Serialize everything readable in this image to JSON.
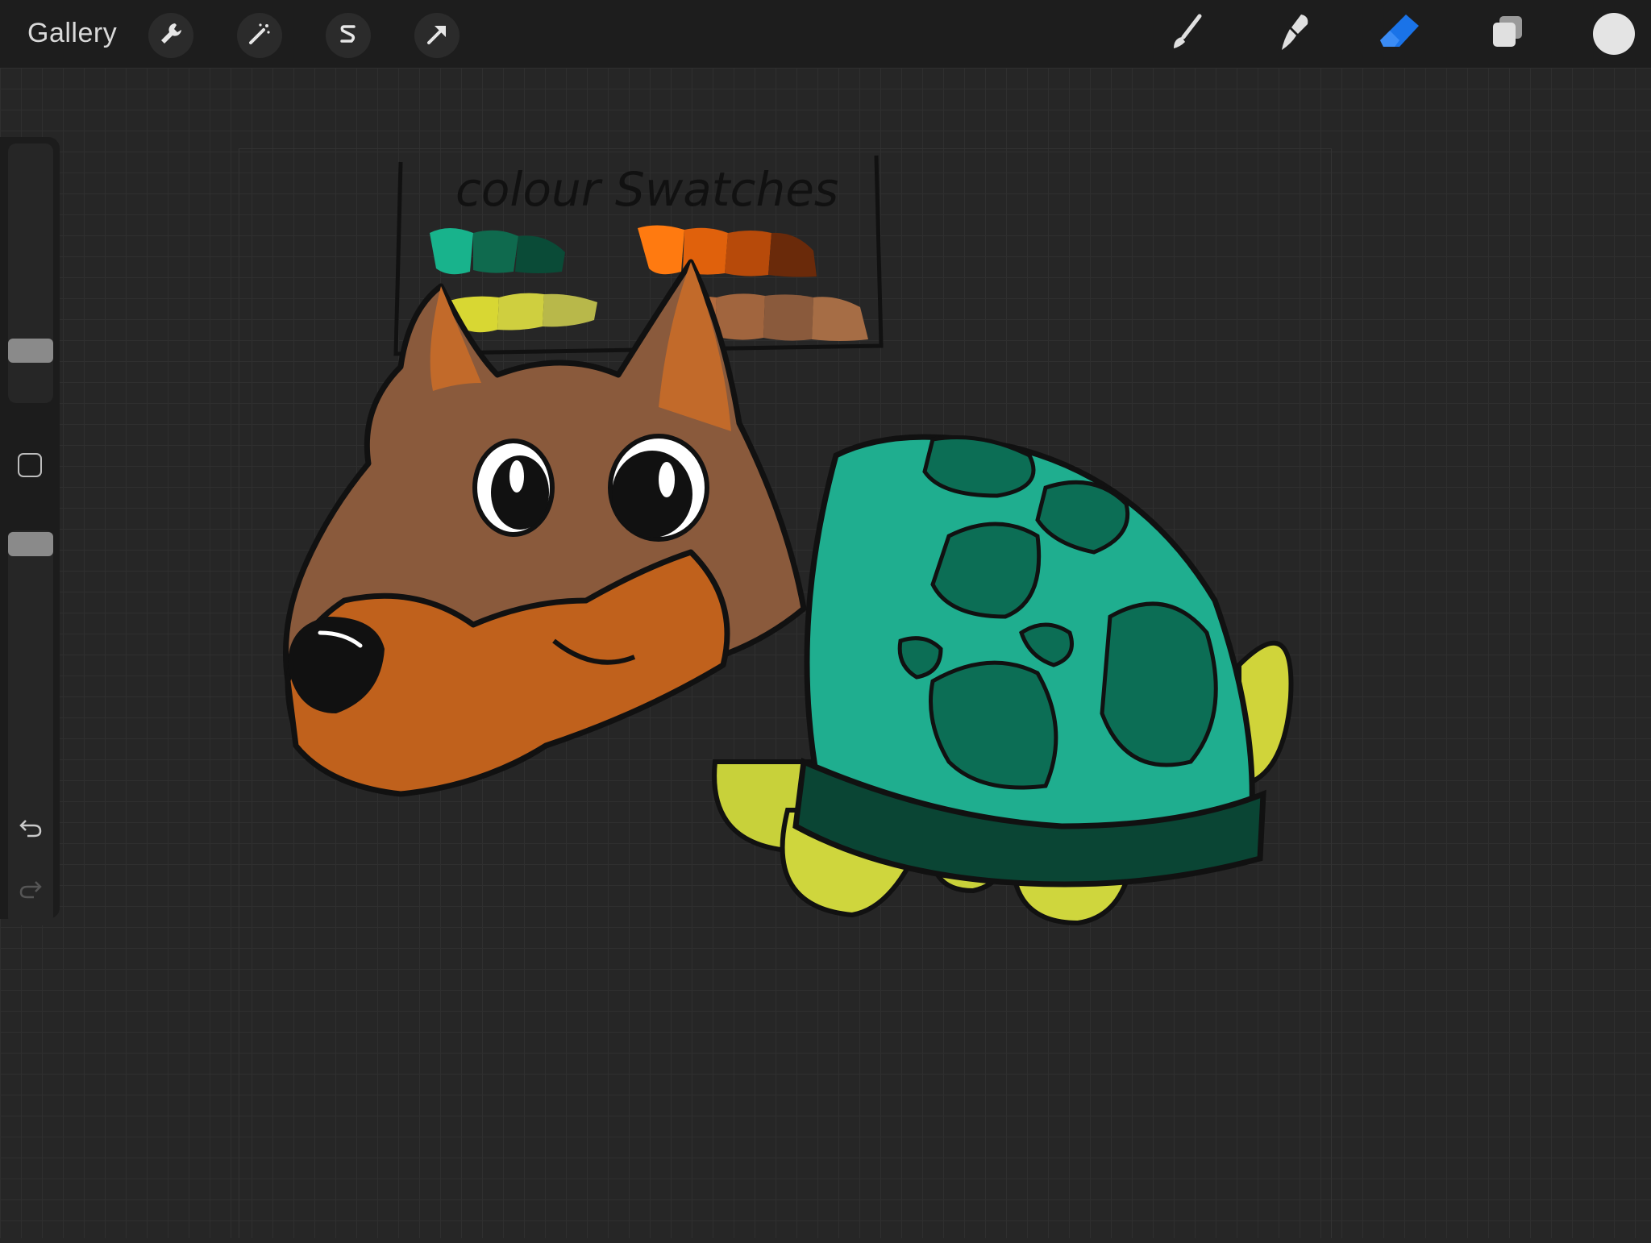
{
  "toolbar": {
    "gallery_label": "Gallery",
    "left_tools": [
      "wrench-icon",
      "magic-wand-icon",
      "selection-s-icon",
      "transform-arrow-icon"
    ],
    "right_tools": [
      "brush-icon",
      "smudge-icon",
      "eraser-icon",
      "layers-icon"
    ],
    "active_tool": "eraser",
    "accent_color": "#1a73e8",
    "current_color": "#e4e4e4"
  },
  "sidebar": {
    "brush_size_level": 0.19,
    "opacity_level": 0.97,
    "buttons": [
      "modify-square-icon",
      "undo-icon",
      "redo-icon"
    ]
  },
  "canvas": {
    "swatch_title": "colour Swatches",
    "swatch_colors": {
      "teal": [
        "#18b38c",
        "#0f6a4e",
        "#0a4b37"
      ],
      "orange": [
        "#ff7a10",
        "#e0610c",
        "#b74a0a",
        "#6a2a0a"
      ],
      "yellow": [
        "#d8d733",
        "#cfcf3f",
        "#b8b84a"
      ],
      "brown": [
        "#b26b3e",
        "#a1653e",
        "#8a5a3c",
        "#a66d45"
      ]
    }
  }
}
